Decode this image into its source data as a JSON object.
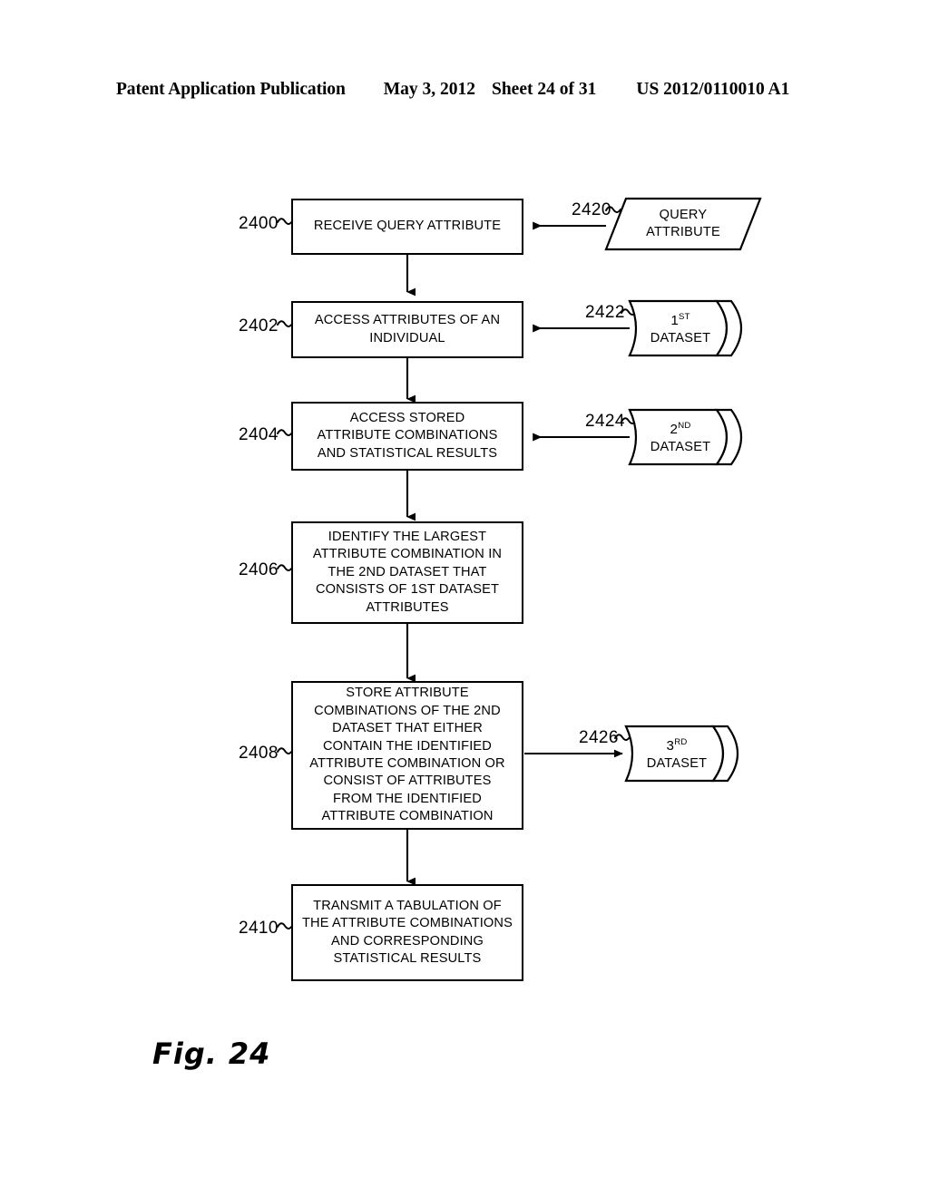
{
  "header": {
    "publication": "Patent Application Publication",
    "date": "May 3, 2012",
    "sheet": "Sheet 24 of 31",
    "number": "US 2012/0110010 A1"
  },
  "figure": {
    "label": "Fig.",
    "number": "24"
  },
  "flow": {
    "steps": [
      {
        "ref": "2400",
        "lines": [
          "RECEIVE QUERY ATTRIBUTE"
        ]
      },
      {
        "ref": "2402",
        "lines": [
          "ACCESS ATTRIBUTES OF AN",
          "INDIVIDUAL"
        ]
      },
      {
        "ref": "2404",
        "lines": [
          "ACCESS STORED",
          "ATTRIBUTE COMBINATIONS",
          "AND STATISTICAL RESULTS"
        ]
      },
      {
        "ref": "2406",
        "lines": [
          "IDENTIFY THE LARGEST",
          "ATTRIBUTE COMBINATION IN",
          "THE 2ND DATASET THAT",
          "CONSISTS OF 1ST DATASET",
          "ATTRIBUTES"
        ]
      },
      {
        "ref": "2408",
        "lines": [
          "STORE ATTRIBUTE",
          "COMBINATIONS OF THE 2ND",
          "DATASET THAT EITHER",
          "CONTAIN THE IDENTIFIED",
          "ATTRIBUTE COMBINATION OR",
          "CONSIST OF ATTRIBUTES",
          "FROM THE IDENTIFIED",
          "ATTRIBUTE COMBINATION"
        ]
      },
      {
        "ref": "2410",
        "lines": [
          "TRANSMIT A TABULATION OF",
          "THE ATTRIBUTE COMBINATIONS",
          "AND CORRESPONDING",
          "STATISTICAL RESULTS"
        ]
      }
    ],
    "data_nodes": [
      {
        "ref": "2420",
        "shape": "parallelogram",
        "lines": [
          "QUERY",
          "ATTRIBUTE"
        ],
        "direction": "input"
      },
      {
        "ref": "2422",
        "shape": "cylinder",
        "ordinal": "1",
        "ordinal_suffix": "ST",
        "label": "DATASET",
        "direction": "input"
      },
      {
        "ref": "2424",
        "shape": "cylinder",
        "ordinal": "2",
        "ordinal_suffix": "ND",
        "label": "DATASET",
        "direction": "input"
      },
      {
        "ref": "2426",
        "shape": "cylinder",
        "ordinal": "3",
        "ordinal_suffix": "RD",
        "label": "DATASET",
        "direction": "output"
      }
    ]
  },
  "colors": {
    "ink": "#000000",
    "paper": "#ffffff"
  }
}
